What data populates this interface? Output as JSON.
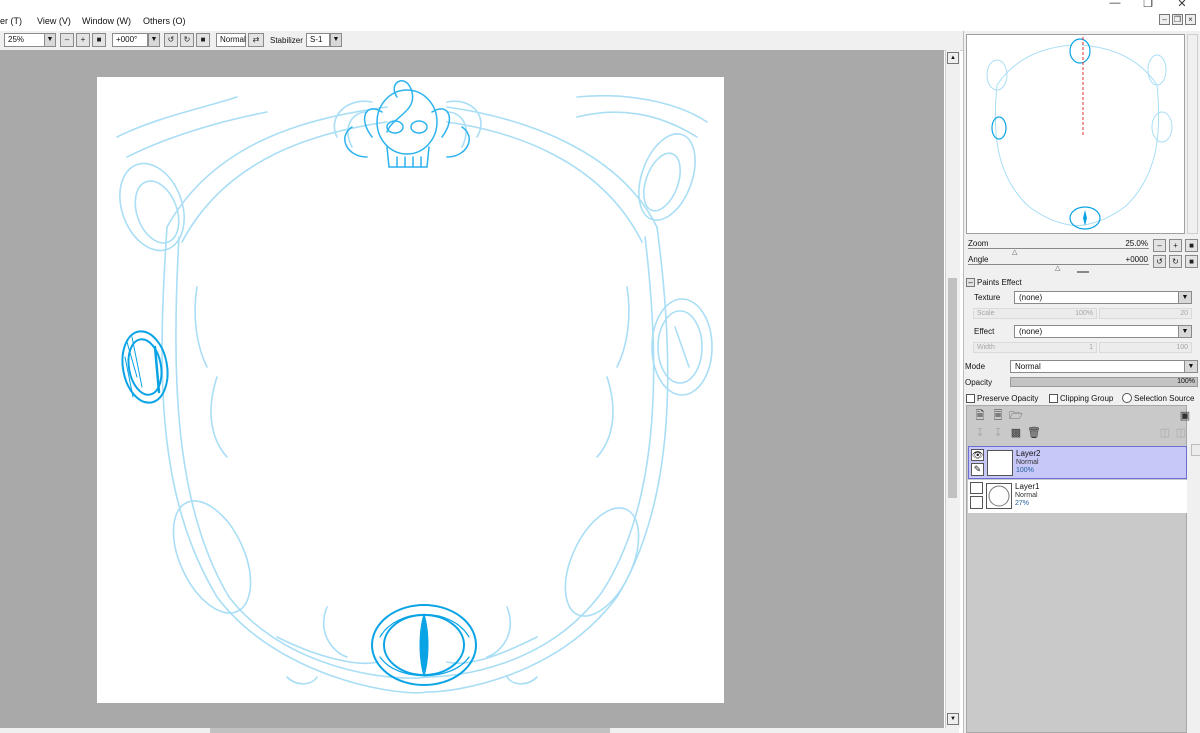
{
  "menu": {
    "items": [
      "er (T)",
      "View (V)",
      "Window (W)",
      "Others (O)"
    ]
  },
  "toolbar": {
    "zoom": "25%",
    "angle": "+000°",
    "blend_mode": "Normal",
    "stabilizer_label": "Stabilizer",
    "stabilizer_value": "S-1"
  },
  "navigator": {
    "zoom_label": "Zoom",
    "zoom_value": "25.0%",
    "angle_label": "Angle",
    "angle_value": "+0000"
  },
  "paints_effect": {
    "title": "Paints Effect",
    "texture_label": "Texture",
    "texture_value": "(none)",
    "scale_label": "Scale",
    "scale_value": "100%",
    "scale_num": "20",
    "effect_label": "Effect",
    "effect_value": "(none)",
    "width_label": "Width",
    "width_value": "1",
    "width_num": "100"
  },
  "layer_props": {
    "mode_label": "Mode",
    "mode_value": "Normal",
    "opacity_label": "Opacity",
    "opacity_value": "100%",
    "preserve_opacity": "Preserve Opacity",
    "clipping_group": "Clipping Group",
    "selection_source": "Selection Source"
  },
  "layers": [
    {
      "name": "Layer2",
      "mode": "Normal",
      "opacity": "100%"
    },
    {
      "name": "Layer1",
      "mode": "Normal",
      "opacity": "27%"
    }
  ],
  "colors": {
    "sketch_light": "#a9def5",
    "sketch_dark": "#0aa3e6",
    "selected_layer": "#c8c8f8",
    "selected_border": "#6d6dd6"
  }
}
